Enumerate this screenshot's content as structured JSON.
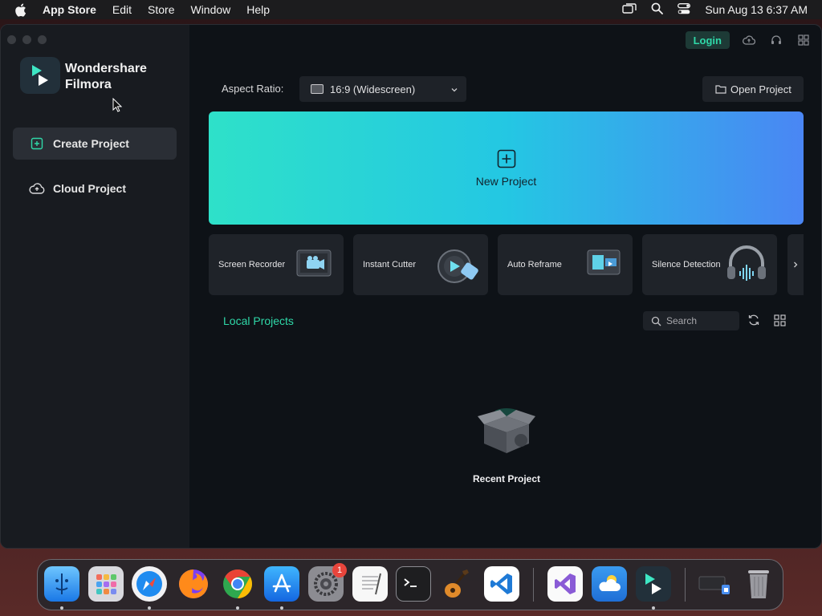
{
  "menubar": {
    "app_name": "App Store",
    "items": [
      "Edit",
      "Store",
      "Window",
      "Help"
    ],
    "clock": "Sun Aug 13  6:37 AM"
  },
  "sidebar": {
    "brand_line1": "Wondershare",
    "brand_line2": "Filmora",
    "items": [
      {
        "label": "Create Project",
        "icon": "plus-square-icon",
        "active": true
      },
      {
        "label": "Cloud Project",
        "icon": "cloud-icon",
        "active": false
      }
    ]
  },
  "header": {
    "login_label": "Login"
  },
  "aspect": {
    "label": "Aspect Ratio:",
    "value": "16:9 (Widescreen)"
  },
  "open_project_label": "Open Project",
  "new_project_label": "New Project",
  "tools": [
    {
      "label": "Screen Recorder"
    },
    {
      "label": "Instant Cutter"
    },
    {
      "label": "Auto Reframe"
    },
    {
      "label": "Silence Detection"
    }
  ],
  "local": {
    "title": "Local Projects",
    "search_placeholder": "Search",
    "empty_label": "Recent Project"
  },
  "dock": {
    "apps": [
      "finder",
      "launchpad",
      "safari",
      "firefox",
      "chrome",
      "app-store",
      "system-settings",
      "textedit",
      "terminal",
      "garageband",
      "vscode",
      "visual-studio",
      "weather",
      "filmora",
      "downloads",
      "trash"
    ],
    "settings_badge": "1"
  },
  "colors": {
    "accent": "#2fd8a8",
    "new_project_gradient": [
      "#2ee1c9",
      "#4a86f4"
    ],
    "window_bg": "#0e1217",
    "sidebar_bg": "#181b20"
  }
}
